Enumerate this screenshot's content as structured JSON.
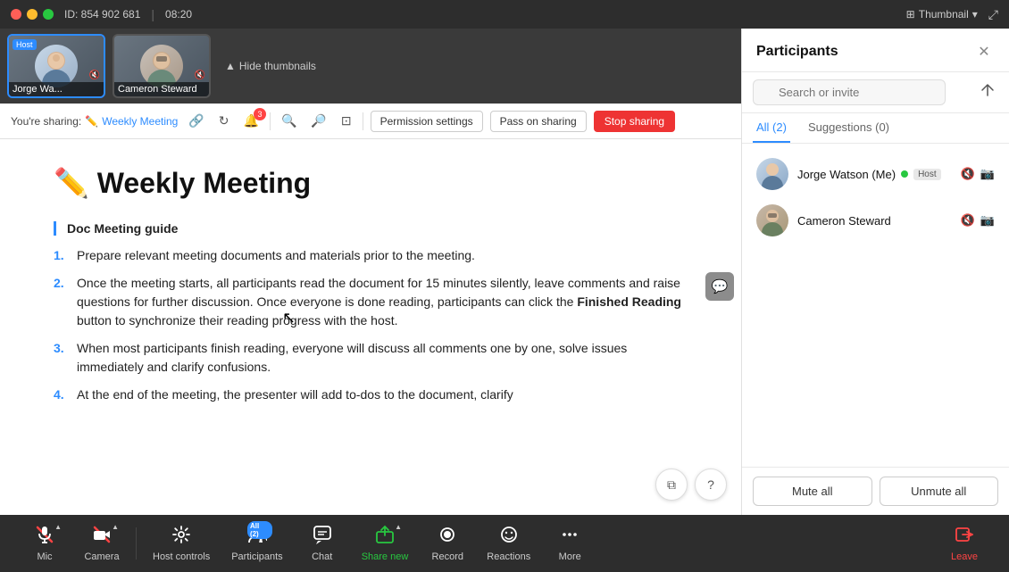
{
  "window": {
    "meeting_id": "ID: 854 902 681",
    "time": "08:20",
    "thumbnail_btn": "Thumbnail",
    "expand_icon": "⤢"
  },
  "thumbnails": {
    "hide_label": "Hide thumbnails",
    "participants": [
      {
        "name": "Jorge Wa...",
        "full_name": "Jorge Watson (Me)",
        "is_host": true,
        "host_label": "Host",
        "is_active": true,
        "muted_audio": true,
        "muted_video": true
      },
      {
        "name": "Cameron Steward",
        "full_name": "Cameron Steward",
        "is_host": false,
        "is_active": false,
        "muted_audio": true,
        "muted_video": false
      }
    ]
  },
  "sharing_bar": {
    "sharing_label": "You're sharing:",
    "doc_name": "Weekly Meeting",
    "notif_count": "3",
    "permission_btn": "Permission settings",
    "pass_btn": "Pass on sharing",
    "stop_btn": "Stop sharing"
  },
  "document": {
    "title": "✏️ Weekly Meeting",
    "section": "Doc Meeting guide",
    "items": [
      "Prepare relevant meeting documents and materials prior to the meeting.",
      "Once the meeting starts, all participants read the document for 15 minutes silently, leave comments and raise questions for further discussion. Once everyone is done reading, participants can click the <b>Finished Reading</b> button to synchronize their reading progress with the host.",
      "When most participants finish reading, everyone will discuss all comments one by one, solve issues immediately and clarify confusions.",
      "At the end of the meeting, the presenter will add to-dos to the document, clarify"
    ]
  },
  "participants_panel": {
    "title": "Participants",
    "search_placeholder": "Search or invite",
    "tabs": [
      {
        "label": "All (2)",
        "active": true
      },
      {
        "label": "Suggestions (0)",
        "active": false
      }
    ],
    "participants": [
      {
        "name": "Jorge Watson (Me)",
        "role": "Host",
        "muted_audio": true,
        "muted_video": true
      },
      {
        "name": "Cameron Steward",
        "role": "",
        "muted_audio": true,
        "muted_video": true
      }
    ],
    "mute_all_btn": "Mute all",
    "unmute_all_btn": "Unmute all"
  },
  "toolbar": {
    "items": [
      {
        "id": "mic",
        "label": "Mic",
        "icon": "🎤",
        "has_chevron": true,
        "danger": true
      },
      {
        "id": "camera",
        "label": "Camera",
        "icon": "📷",
        "has_chevron": true,
        "danger": true
      },
      {
        "id": "host-controls",
        "label": "Host controls",
        "icon": "⚙",
        "has_chevron": false
      },
      {
        "id": "participants",
        "label": "Participants",
        "icon": "👥",
        "badge": "2",
        "has_chevron": false
      },
      {
        "id": "chat",
        "label": "Chat",
        "icon": "💬",
        "has_chevron": false
      },
      {
        "id": "share-new",
        "label": "Share new",
        "icon": "⬆",
        "has_chevron": true,
        "active": true
      },
      {
        "id": "record",
        "label": "Record",
        "icon": "⏺",
        "has_chevron": false
      },
      {
        "id": "reactions",
        "label": "Reactions",
        "icon": "😊",
        "has_chevron": false
      },
      {
        "id": "more",
        "label": "More",
        "icon": "•••",
        "has_chevron": false
      },
      {
        "id": "leave",
        "label": "Leave",
        "icon": "📵",
        "danger": true
      }
    ]
  }
}
